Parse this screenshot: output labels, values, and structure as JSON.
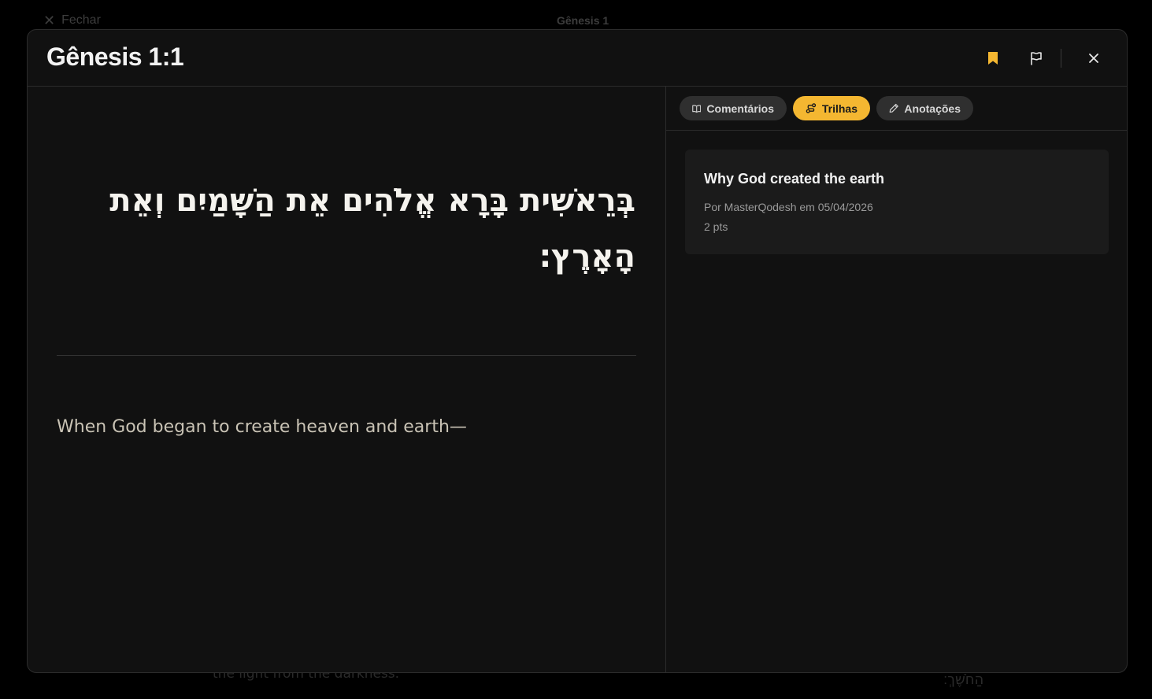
{
  "background": {
    "close_label": "Fechar",
    "title": "Gênesis 1",
    "bottom_left_text": "the light from the darkness.",
    "bottom_right_text": "הַחֹשֶׁךְ׃"
  },
  "modal": {
    "title": "Gênesis 1:1",
    "header_icons": {
      "bookmark": "bookmark-filled-icon",
      "report": "flag-icon",
      "close": "close-icon"
    },
    "hebrew_text": "בְּרֵאשִׁית בָּרָא אֱלֹהִים אֵת הַשָּׁמַיִם וְאֵת הָאָרֶץ׃",
    "translation": "When God began to create heaven and earth—",
    "tabs": [
      {
        "label": "Comentários",
        "icon": "book-open-icon",
        "active": false
      },
      {
        "label": "Trilhas",
        "icon": "route-icon",
        "active": true
      },
      {
        "label": "Anotações",
        "icon": "pencil-icon",
        "active": false
      }
    ],
    "trail_card": {
      "title": "Why God created the earth",
      "meta": "Por MasterQodesh em 05/04/2026",
      "points": "2 pts"
    }
  },
  "colors": {
    "accent": "#f4b731",
    "modal_bg": "#111111",
    "card_bg": "#1b1b1b",
    "translation_text": "#c9c3b5"
  }
}
